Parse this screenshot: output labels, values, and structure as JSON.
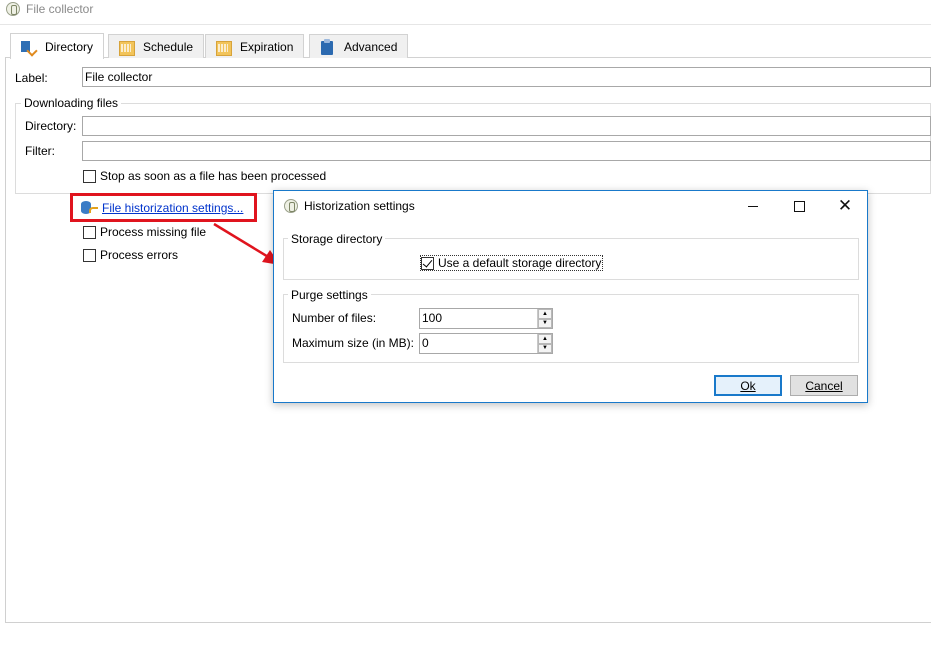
{
  "window": {
    "title": "File collector"
  },
  "tabs": [
    {
      "label": "Directory",
      "icon": "directory-icon",
      "active": true
    },
    {
      "label": "Schedule",
      "icon": "calendar-icon",
      "active": false
    },
    {
      "label": "Expiration",
      "icon": "calendar-icon",
      "active": false
    },
    {
      "label": "Advanced",
      "icon": "clipboard-icon",
      "active": false
    }
  ],
  "form": {
    "label_caption": "Label:",
    "label_value": "File collector",
    "downloading": {
      "title": "Downloading files",
      "directory_caption": "Directory:",
      "directory_value": "",
      "filter_caption": "Filter:",
      "filter_value": "",
      "stop_caption": "Stop as soon as a file has been processed",
      "stop_checked": false
    },
    "historization_link": "File historization settings...",
    "process_missing": "Process missing file",
    "process_errors": "Process errors"
  },
  "dialog": {
    "title": "Historization settings",
    "storage": {
      "title": "Storage directory",
      "default_caption": "Use a default storage directory",
      "default_checked": true
    },
    "purge": {
      "title": "Purge settings",
      "files_caption": "Number of files:",
      "files_value": "100",
      "size_caption": "Maximum size (in MB):",
      "size_value": "0"
    },
    "ok_label": "Ok",
    "cancel_label": "Cancel"
  },
  "colors": {
    "highlight": "#e0141e",
    "accent": "#1979ca",
    "link": "#0033cc"
  }
}
